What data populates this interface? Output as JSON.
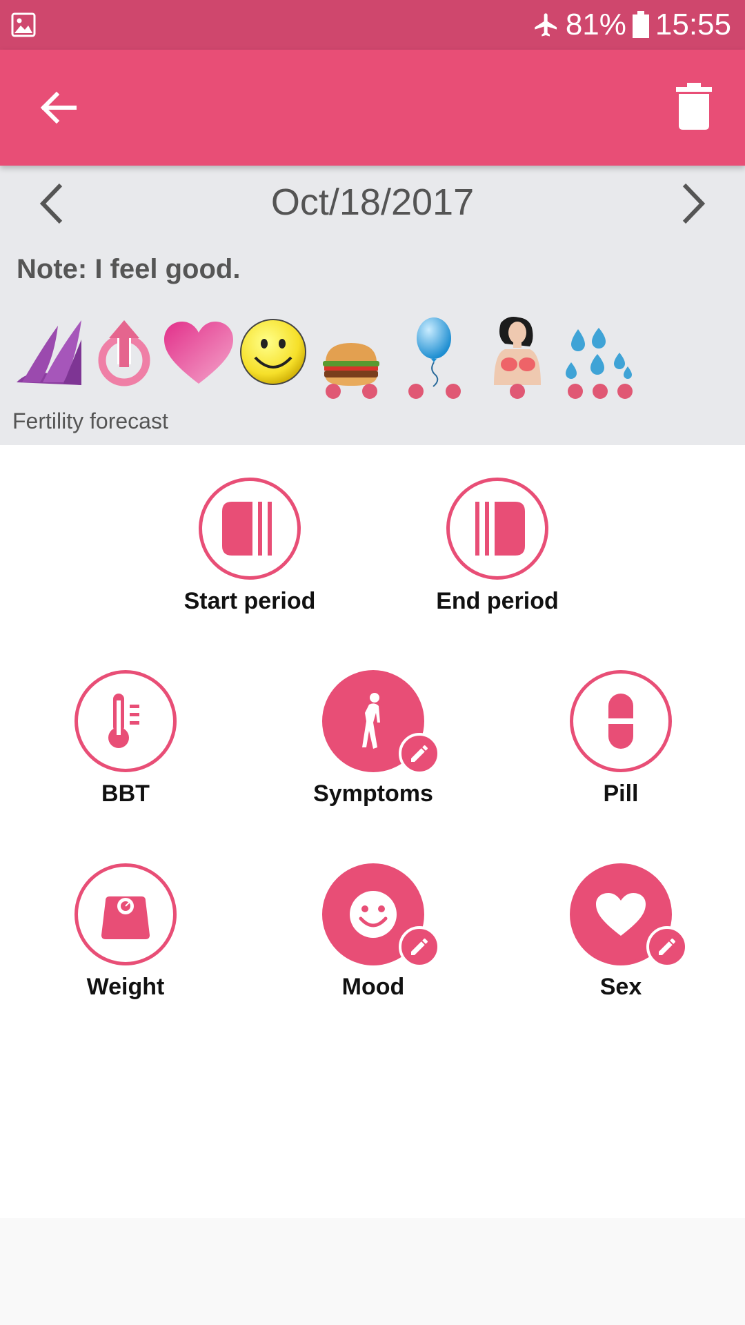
{
  "status_bar": {
    "battery_percent": "81%",
    "time": "15:55",
    "icons": [
      "image-notification-icon",
      "airplane-mode-icon",
      "battery-icon"
    ]
  },
  "app_bar": {
    "icons": [
      "back-arrow-icon",
      "trash-icon"
    ]
  },
  "day": {
    "date": "Oct/18/2017",
    "note": "Note: I feel good.",
    "forecast_label": "Fertility forecast",
    "indicators": [
      {
        "name": "fertility-fan-icon",
        "dots": 0
      },
      {
        "name": "power-up-icon",
        "dots": 0
      },
      {
        "name": "heart-icon",
        "dots": 0
      },
      {
        "name": "smiley-icon",
        "dots": 0
      },
      {
        "name": "burger-icon",
        "dots": 2
      },
      {
        "name": "balloon-icon",
        "dots": 2
      },
      {
        "name": "breast-tenderness-icon",
        "dots": 1
      },
      {
        "name": "water-drops-icon",
        "dots": 3
      }
    ]
  },
  "actions": {
    "start_period": "Start period",
    "end_period": "End period",
    "bbt": "BBT",
    "symptoms": "Symptoms",
    "pill": "Pill",
    "weight": "Weight",
    "mood": "Mood",
    "sex": "Sex"
  },
  "colors": {
    "status_bar": "#cf476d",
    "app_bar": "#e84e76",
    "accent": "#e84e76",
    "panel_bg": "#e8e9ec",
    "dot": "#e05874"
  }
}
